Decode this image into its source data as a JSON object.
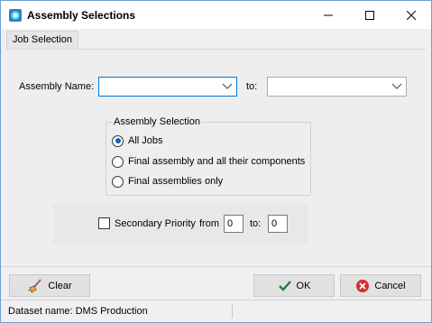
{
  "window": {
    "title": "Assembly Selections"
  },
  "tabs": [
    {
      "label": "Job Selection"
    }
  ],
  "form": {
    "assembly_name_label": "Assembly Name:",
    "to_label": "to:",
    "assembly_from_value": "",
    "assembly_to_value": ""
  },
  "assembly_selection": {
    "title": "Assembly Selection",
    "options": [
      {
        "label": "All Jobs",
        "checked": true
      },
      {
        "label": "Final assembly and all their components",
        "checked": false
      },
      {
        "label": "Final assemblies only",
        "checked": false
      }
    ]
  },
  "secondary_priority": {
    "label": "Secondary Priority",
    "checked": false,
    "from_label": "from",
    "from_value": "0",
    "to_label": "to:",
    "to_value": "0"
  },
  "buttons": {
    "clear": "Clear",
    "ok": "OK",
    "cancel": "Cancel"
  },
  "status": {
    "dataset": "Dataset name:  DMS Production"
  },
  "colors": {
    "accent": "#0078d7",
    "ok_check": "#2e7d32",
    "cancel_red": "#d32f2f"
  }
}
